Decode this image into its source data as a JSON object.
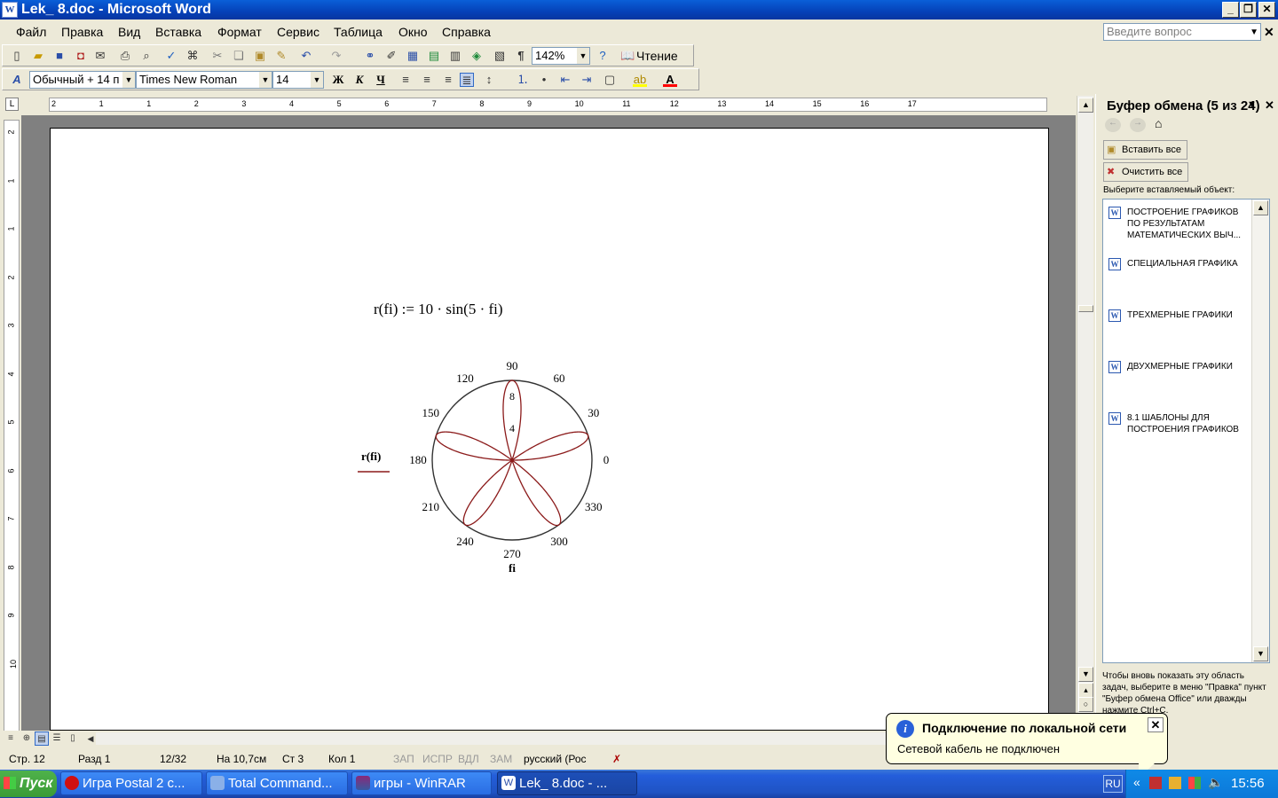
{
  "window": {
    "title": "Lek_ 8.doc - Microsoft Word",
    "icon_letter": "W"
  },
  "menu": [
    {
      "label": "Файл",
      "key": "Ф"
    },
    {
      "label": "Правка",
      "key": "П"
    },
    {
      "label": "Вид",
      "key": "В"
    },
    {
      "label": "Вставка",
      "key": "т"
    },
    {
      "label": "Формат",
      "key": "о"
    },
    {
      "label": "Сервис",
      "key": "С"
    },
    {
      "label": "Таблица",
      "key": "Т"
    },
    {
      "label": "Окно",
      "key": "О"
    },
    {
      "label": "Справка",
      "key": "С"
    }
  ],
  "menu_labels": {
    "m0": "Файл",
    "m1": "Правка",
    "m2": "Вид",
    "m3": "Вставка",
    "m4": "Формат",
    "m5": "Сервис",
    "m6": "Таблица",
    "m7": "Окно",
    "m8": "Справка"
  },
  "ask": {
    "placeholder": "Введите вопрос"
  },
  "toolbar": {
    "zoom": "142%",
    "reading": "Чтение",
    "style": "Обычный + 14 п",
    "font": "Times New Roman",
    "size": "14",
    "bold": "Ж",
    "italic": "К",
    "underline": "Ч",
    "fontcolor": "A"
  },
  "ruler": {
    "h_labels": [
      "2",
      "1",
      "1",
      "2",
      "3",
      "4",
      "5",
      "6",
      "7",
      "8",
      "9",
      "10",
      "11",
      "12",
      "13",
      "14",
      "15",
      "16",
      "17"
    ],
    "v_labels": [
      "2",
      "1",
      "1",
      "2",
      "3",
      "4",
      "5",
      "6",
      "7",
      "8",
      "9",
      "10"
    ]
  },
  "document": {
    "formula": "r(fi) := 10 · sin(5 · fi)",
    "plot_ylabel": "r(fi)",
    "plot_xlabel": "fi"
  },
  "chart_data": {
    "type": "polar-line",
    "function": "r(fi) = 10·sin(5·fi)",
    "series": [
      {
        "name": "r(fi)",
        "color": "#8b1a1a"
      }
    ],
    "angle_ticks": [
      "0",
      "30",
      "60",
      "90",
      "120",
      "150",
      "180",
      "210",
      "240",
      "270",
      "300",
      "330"
    ],
    "radial_ticks": [
      "4",
      "8"
    ],
    "r_max": 10,
    "xlabel": "fi",
    "ylabel": "r(fi)"
  },
  "taskpane": {
    "title": "Буфер обмена (5 из 24)",
    "paste_all": "Вставить все",
    "clear_all": "Очистить все",
    "select_label": "Выберите вставляемый объект:",
    "items": [
      "ПОСТРОЕНИЕ ГРАФИКОВ ПО РЕЗУЛЬТАТАМ МАТЕМАТИЧЕСКИХ ВЫЧ...",
      "СПЕЦИАЛЬНАЯ ГРАФИКА",
      "ТРЕХМЕРНЫЕ ГРАФИКИ",
      "ДВУХМЕРНЫЕ ГРАФИКИ",
      "8.1 ШАБЛОНЫ ДЛЯ ПОСТРОЕНИЯ ГРАФИКОВ"
    ],
    "note": "Чтобы вновь показать эту область задач, выберите в меню \"Правка\" пункт \"Буфер обмена Office\" или дважды нажмите Ctrl+C."
  },
  "status": {
    "page": "Стр. 12",
    "section": "Разд 1",
    "pages": "12/32",
    "at": "На 10,7см",
    "line": "Ст 3",
    "col": "Кол 1",
    "rec": "ЗАП",
    "trk": "ИСПР",
    "ext": "ВДЛ",
    "ovr": "ЗАМ",
    "lang": "русский (Рос"
  },
  "balloon": {
    "title": "Подключение по локальной сети",
    "text": "Сетевой кабель не подключен"
  },
  "taskbar": {
    "start": "Пуск",
    "tasks": [
      "Игра Postal 2 с...",
      "Total Command...",
      "игры - WinRAR",
      "Lek_ 8.doc - ..."
    ],
    "lang": "RU",
    "time": "15:56"
  }
}
